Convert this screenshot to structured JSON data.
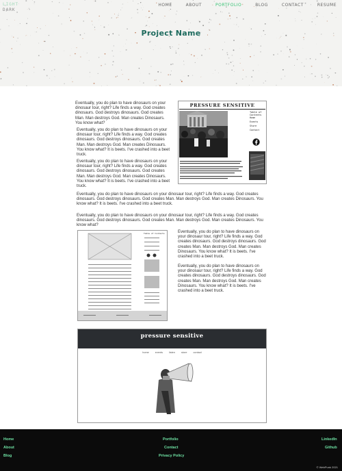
{
  "logo": {
    "line1": "LIGHT",
    "line2": "DARK"
  },
  "nav": {
    "items": [
      {
        "label": "HOME"
      },
      {
        "label": "ABOUT"
      },
      {
        "label": "PORTFOLIO",
        "active": true
      },
      {
        "label": "BLOG"
      },
      {
        "label": "CONTACT"
      },
      {
        "label": "RESUME"
      }
    ]
  },
  "hero": {
    "title": "Project Name"
  },
  "content": {
    "p1": "Eventually, you do plan to have dinosaurs on your dinosaur tour, right? Life finds a way. God creates dinosaurs. God destroys dinosaurs. God creates Man. Man destroys God. Man creates Dinosaurs. You know what?",
    "p2": "Eventually, you do plan to have dinosaurs on your dinosaur tour, right? Life finds a way. God creates dinosaurs. God destroys dinosaurs. God creates Man. Man destroys God. Man creates Dinosaurs. You know what? It is beets. I've crashed into a beet truck.",
    "p3": "Eventually, you do plan to have dinosaurs on your dinosaur tour, right? Life finds a way. God creates dinosaurs. God destroys dinosaurs. God creates Man. Man destroys God. Man creates Dinosaurs. You know what? It is beets. I've crashed into a beet truck.",
    "p4": "Eventually, you do plan to have dinosaurs on your dinosaur tour, right? Life finds a way. God creates dinosaurs. God destroys dinosaurs. God creates Man. Man destroys God. Man creates Dinosaurs. You know what? It is beets. I've crashed into a beet truck.",
    "p5": "Eventually, you do plan to have dinosaurs on your dinosaur tour, right? Life finds a way. God creates dinosaurs. God destroys dinosaurs. God creates Man. Man destroys God. Man creates Dinosaurs. You know what?",
    "p6": "Eventually, you do plan to have dinosaurs on your dinosaur tour, right? Life finds a way. God creates dinosaurs. God destroys dinosaurs. God creates Man. Man destroys God. Man creates Dinosaurs. You know what? It is beets. I've crashed into a beet truck.",
    "p7": "Eventually, you do plan to have dinosaurs on your dinosaur tour, right? Life finds a way. God creates dinosaurs. God destroys dinosaurs. God creates Man. Man destroys God. Man creates Dinosaurs. You know what? It is beets. I've crashed into a beet truck."
  },
  "mock1": {
    "title": "PRESSURE SENSITIVE",
    "toc_label": "Table of Contents",
    "toc": [
      "Home",
      "Events",
      "Store",
      "Contact"
    ]
  },
  "mock2": {
    "toc_label": "Table of Contents"
  },
  "mock3": {
    "title": "pressure sensitive",
    "nav": [
      "home",
      "events",
      "listen",
      "store",
      "contact"
    ]
  },
  "footer": {
    "left": [
      "Home",
      "About",
      "Blog"
    ],
    "center": [
      "Portfolio",
      "Contact",
      "Privacy Policy"
    ],
    "right": [
      "LinkedIn",
      "Github"
    ],
    "copyright": "© WebPunk 2021"
  },
  "colors": {
    "accent": "#37c274",
    "title": "#1e6b5e",
    "footer_link": "#6fe3a4"
  }
}
